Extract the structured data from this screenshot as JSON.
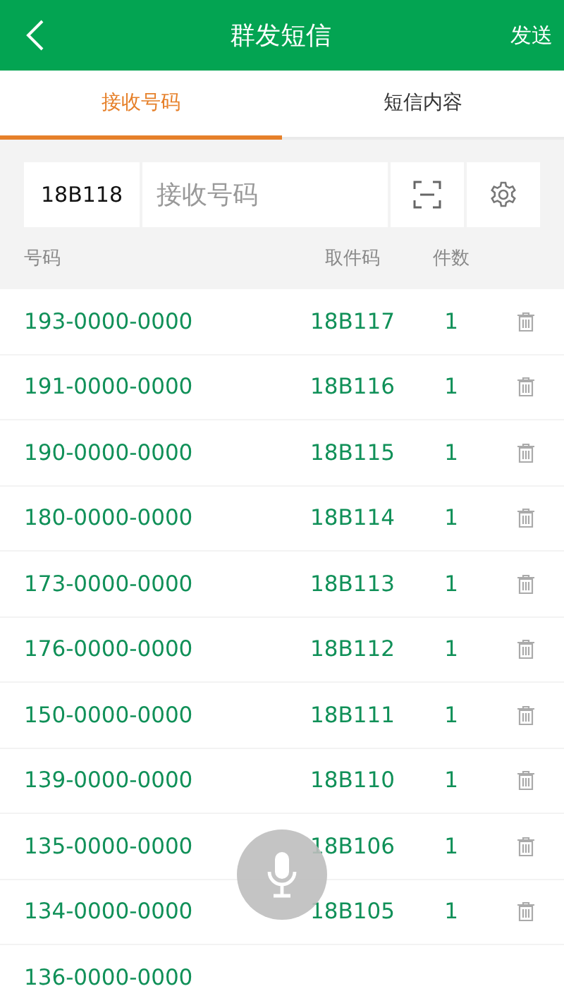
{
  "header": {
    "title": "群发短信",
    "action": "发送"
  },
  "tabs": [
    {
      "label": "接收号码",
      "selected": true
    },
    {
      "label": "短信内容",
      "selected": false
    }
  ],
  "input": {
    "code": "18B118",
    "placeholder": "接收号码"
  },
  "columns": [
    "号码",
    "取件码",
    "件数"
  ],
  "rows": [
    {
      "phone": "193-0000-0000",
      "code": "18B117",
      "count": "1"
    },
    {
      "phone": "191-0000-0000",
      "code": "18B116",
      "count": "1"
    },
    {
      "phone": "190-0000-0000",
      "code": "18B115",
      "count": "1"
    },
    {
      "phone": "180-0000-0000",
      "code": "18B114",
      "count": "1"
    },
    {
      "phone": "173-0000-0000",
      "code": "18B113",
      "count": "1"
    },
    {
      "phone": "176-0000-0000",
      "code": "18B112",
      "count": "1"
    },
    {
      "phone": "150-0000-0000",
      "code": "18B111",
      "count": "1"
    },
    {
      "phone": "139-0000-0000",
      "code": "18B110",
      "count": "1"
    },
    {
      "phone": "135-0000-0000",
      "code": "18B106",
      "count": "1"
    },
    {
      "phone": "134-0000-0000",
      "code": "18B105",
      "count": "1"
    },
    {
      "phone": "136-0000-0000"
    }
  ]
}
